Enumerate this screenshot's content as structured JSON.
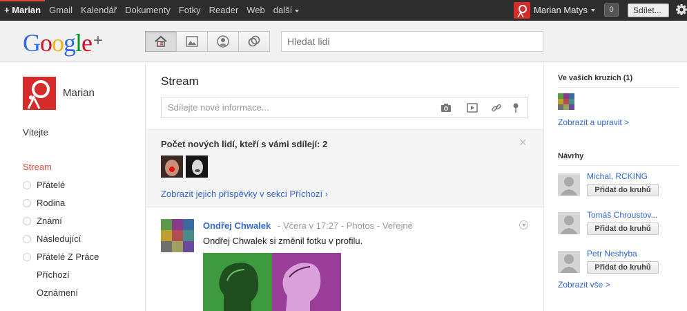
{
  "topbar": {
    "nav": [
      "+ Marian",
      "Gmail",
      "Kalendář",
      "Dokumenty",
      "Fotky",
      "Reader",
      "Web",
      "další"
    ],
    "user_name": "Marian Matys",
    "notification_count": "0",
    "share_label": "Sdílet..."
  },
  "header": {
    "logo_text": "Google",
    "logo_plus": "+",
    "search_placeholder": "Hledat lidi",
    "tabs": [
      "home-icon",
      "photos-icon",
      "profile-icon",
      "circles-icon"
    ]
  },
  "left": {
    "profile_name": "Marian",
    "welcome": "Vítejte",
    "stream": "Stream",
    "circles": [
      "Přátelé",
      "Rodina",
      "Známí",
      "Následující",
      "Přátelé Z Práce"
    ],
    "extra": [
      "Příchozí",
      "Oznámení"
    ]
  },
  "center": {
    "title": "Stream",
    "share_placeholder": "Sdílejte nové informace...",
    "notice_title": "Počet nových lidí, kteří s vámi sdílejí: 2",
    "notice_link": "Zobrazit jejich příspěvky v sekci Příchozí ›",
    "notice_close": "×",
    "post": {
      "author": "Ondřej Chwalek",
      "meta": "-  Včera v 17:27  -  Photos  -  Veřejné",
      "text": "Ondřej Chwalek si změnil fotku v profilu."
    }
  },
  "right": {
    "circles_title": "Ve vašich kruzích (1)",
    "circles_link": "Zobrazit a upravit >",
    "suggest_title": "Návrhy",
    "suggestions": [
      {
        "name": "Michal, RCKING",
        "button": "Přidat do kruhů"
      },
      {
        "name": "Tomáš Chroustov...",
        "button": "Přidat do kruhů"
      },
      {
        "name": "Petr Neshyba",
        "button": "Přidat do kruhů"
      }
    ],
    "all_link": "Zobrazit vše >"
  },
  "colors": {
    "accent_red": "#dd4b39",
    "link_blue": "#3366cc",
    "topbar_bg": "#2d2d2d"
  }
}
